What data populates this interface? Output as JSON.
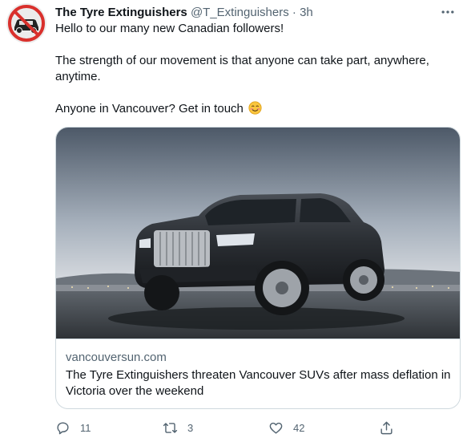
{
  "tweet": {
    "author_name": "The Tyre Extinguishers",
    "author_handle": "@T_Extinguishers",
    "separator": "·",
    "time": "3h",
    "text_line1": "Hello to our many new Canadian followers!",
    "text_line2": "The strength of our movement is that anyone can take part, anywhere, anytime.",
    "text_line3": "Anyone in Vancouver? Get in touch",
    "emoji_icon": "smiling-face-emoji"
  },
  "card": {
    "domain": "vancouversun.com",
    "title": "The Tyre Extinguishers threaten Vancouver SUVs after mass deflation in Victoria over the weekend"
  },
  "actions": {
    "reply_count": "11",
    "retweet_count": "3",
    "like_count": "42"
  },
  "colors": {
    "text": "#0f1419",
    "secondary": "#536471",
    "border": "#cfd9de",
    "prohibit_red": "#d9302c"
  }
}
